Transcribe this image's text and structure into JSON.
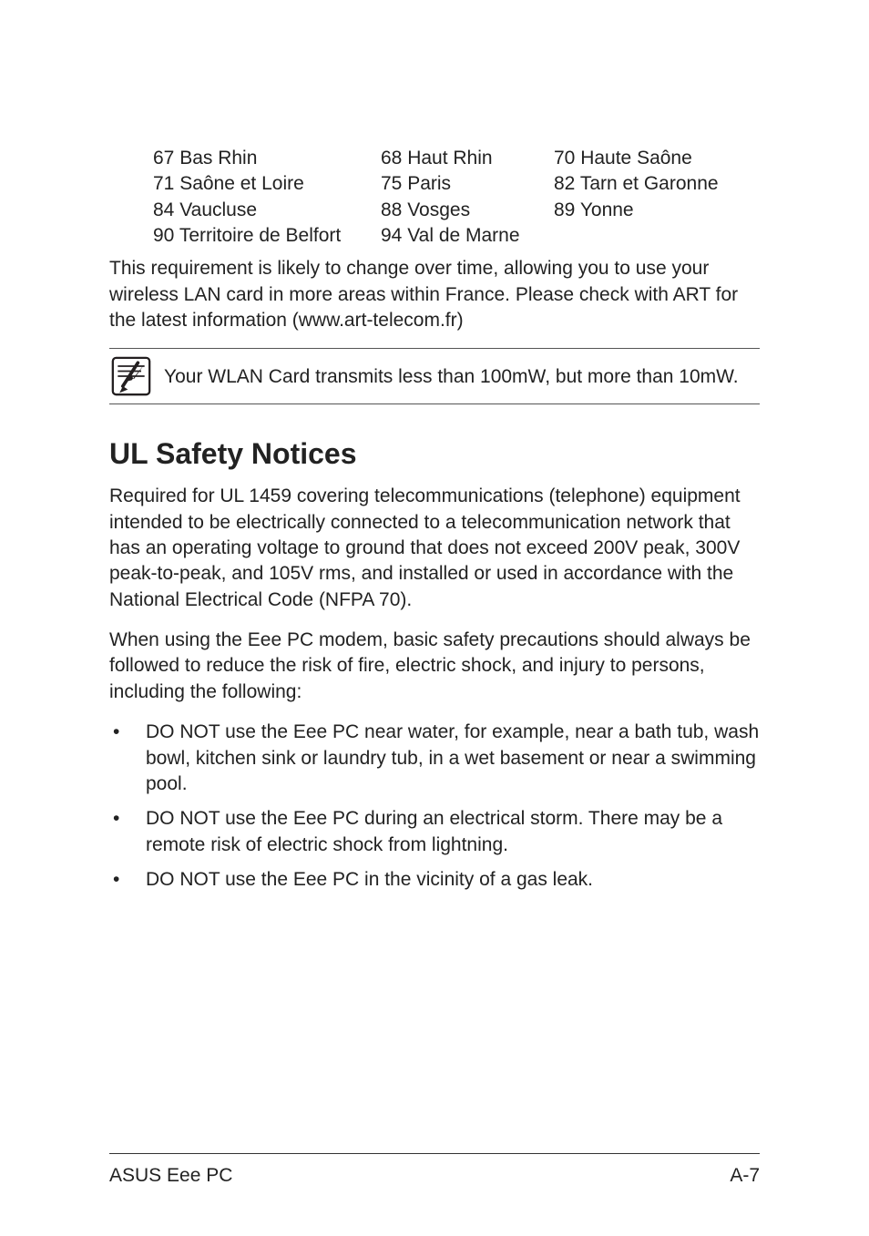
{
  "departments": {
    "rows": [
      {
        "c1": "67  Bas Rhin",
        "c2": "68   Haut Rhin",
        "c3": "70  Haute Saône"
      },
      {
        "c1": "71  Saône et Loire",
        "c2": "75   Paris",
        "c3": "82  Tarn et Garonne"
      },
      {
        "c1": "84  Vaucluse",
        "c2": "88   Vosges",
        "c3": "89  Yonne"
      },
      {
        "c1": "90  Territoire de Belfort",
        "c2": "94   Val de Marne",
        "c3": ""
      }
    ]
  },
  "intro_after_table": "This requirement is likely to change over time, allowing you to use your wireless LAN card in more areas within France. Please check with ART for the latest information (www.art-telecom.fr)",
  "note": "Your WLAN Card transmits less than 100mW, but more than 10mW.",
  "section_heading": "UL Safety Notices",
  "para1": "Required for UL 1459 covering telecommunications (telephone) equipment intended to be electrically connected to a telecommunication network that has an operating voltage to ground that does not exceed 200V peak, 300V peak-to-peak, and 105V rms, and installed or used in accordance with the National Electrical Code (NFPA 70).",
  "para2": "When using the Eee PC modem, basic safety precautions should always be followed to reduce the risk of fire, electric shock, and injury to persons, including the following:",
  "bullets": [
    "DO NOT use the Eee PC near water, for example, near a bath tub, wash bowl, kitchen sink or laundry tub, in a wet basement or near a swimming pool.",
    "DO NOT use the Eee PC during an electrical storm. There may be a remote risk of electric shock from lightning.",
    "DO NOT use the Eee PC in the vicinity of a gas leak."
  ],
  "footer": {
    "left": "ASUS Eee PC",
    "right": "A-7"
  }
}
